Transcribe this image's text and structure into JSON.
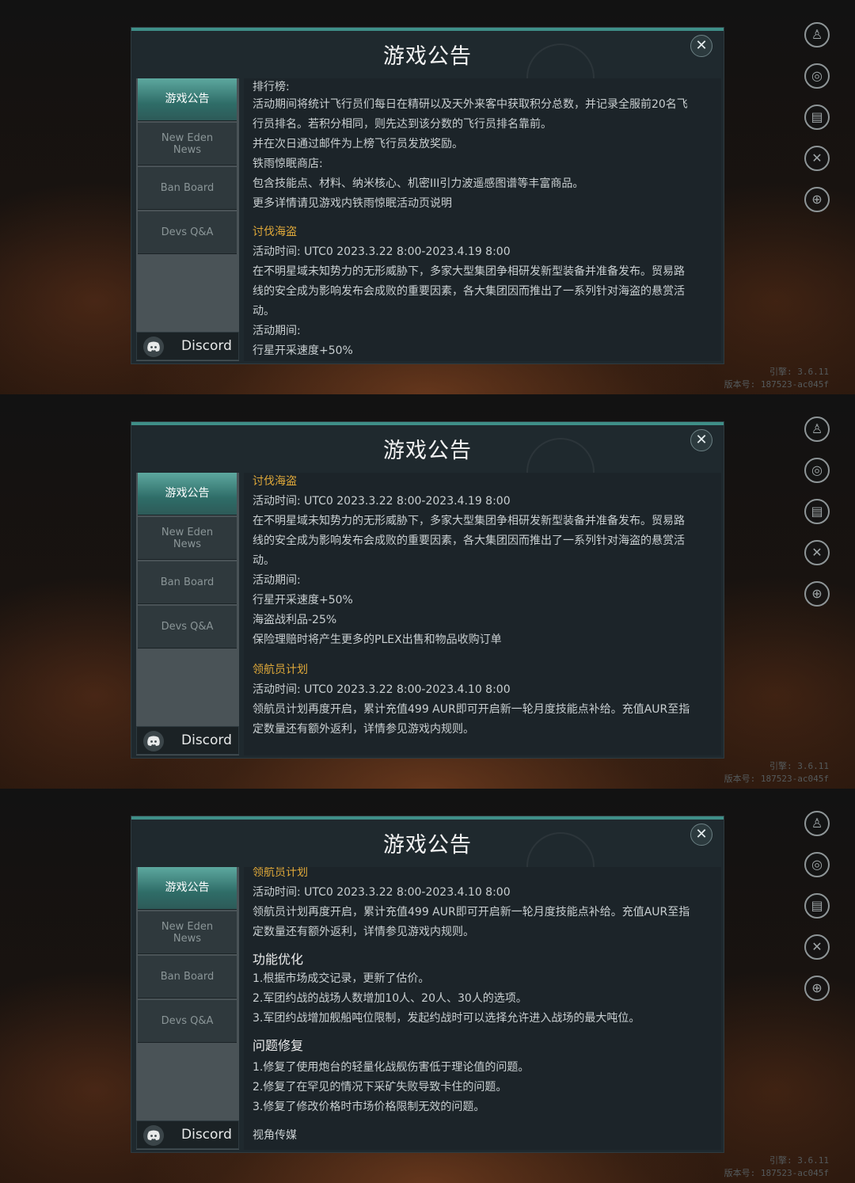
{
  "dialog_title": "游戏公告",
  "close_symbol": "✕",
  "tabs": [
    "游戏公告",
    "New Eden\nNews",
    "Ban Board",
    "Devs Q&A"
  ],
  "discord_label": "Discord",
  "version_engine": "引擎: 3.6.11",
  "version_build": "版本号: 187523-ac045f",
  "rail_icons": [
    "profile-icon",
    "signal-icon",
    "notes-icon",
    "tools-icon",
    "globe-icon"
  ],
  "frames": [
    {
      "lines": [
        {
          "text": "排行榜:",
          "style": "normal"
        },
        {
          "text": "活动期间将统计飞行员们每日在精研以及天外来客中获取积分总数，并记录全服前20名飞",
          "style": "normal"
        },
        {
          "text": "行员排名。若积分相同，则先达到该分数的飞行员排名靠前。",
          "style": "normal"
        },
        {
          "text": "并在次日通过邮件为上榜飞行员发放奖励。",
          "style": "normal"
        },
        {
          "text": "铁雨惊眠商店:",
          "style": "normal"
        },
        {
          "text": "包含技能点、材料、纳米核心、机密III引力波遥感图谱等丰富商品。",
          "style": "normal"
        },
        {
          "text": "更多详情请见游戏内铁雨惊眠活动页说明",
          "style": "normal"
        },
        {
          "text": "讨伐海盗",
          "style": "hl"
        },
        {
          "text": "活动时间: UTC0 2023.3.22 8:00-2023.4.19 8:00",
          "style": "normal"
        },
        {
          "text": "在不明星域未知势力的无形威胁下，多家大型集团争相研发新型装备并准备发布。贸易路",
          "style": "normal"
        },
        {
          "text": "线的安全成为影响发布会成败的重要因素，各大集团因而推出了一系列针对海盗的悬赏活",
          "style": "normal"
        },
        {
          "text": "动。",
          "style": "normal"
        },
        {
          "text": "活动期间:",
          "style": "normal"
        },
        {
          "text": "行星开采速度+50%",
          "style": "normal"
        }
      ]
    },
    {
      "lines": [
        {
          "text": "讨伐海盗",
          "style": "hl"
        },
        {
          "text": "活动时间: UTC0 2023.3.22 8:00-2023.4.19 8:00",
          "style": "normal"
        },
        {
          "text": "在不明星域未知势力的无形威胁下，多家大型集团争相研发新型装备并准备发布。贸易路",
          "style": "normal"
        },
        {
          "text": "线的安全成为影响发布会成败的重要因素，各大集团因而推出了一系列针对海盗的悬赏活",
          "style": "normal"
        },
        {
          "text": "动。",
          "style": "normal"
        },
        {
          "text": "活动期间:",
          "style": "normal"
        },
        {
          "text": "行星开采速度+50%",
          "style": "normal"
        },
        {
          "text": "海盗战利品-25%",
          "style": "normal"
        },
        {
          "text": "保险理赔时将产生更多的PLEX出售和物品收购订单",
          "style": "normal"
        },
        {
          "text": "领航员计划",
          "style": "hl"
        },
        {
          "text": "活动时间: UTC0 2023.3.22 8:00-2023.4.10 8:00",
          "style": "normal"
        },
        {
          "text": "领航员计划再度开启，累计充值499 AUR即可开启新一轮月度技能点补给。充值AUR至指",
          "style": "normal"
        },
        {
          "text": "定数量还有额外返利，详情参见游戏内规则。",
          "style": "normal"
        }
      ]
    },
    {
      "lines": [
        {
          "text": "领航员计划",
          "style": "hl"
        },
        {
          "text": "活动时间: UTC0 2023.3.22 8:00-2023.4.10 8:00",
          "style": "normal"
        },
        {
          "text": "领航员计划再度开启，累计充值499 AUR即可开启新一轮月度技能点补给。充值AUR至指",
          "style": "normal"
        },
        {
          "text": "定数量还有额外返利，详情参见游戏内规则。",
          "style": "normal"
        },
        {
          "text": "功能优化",
          "style": "section"
        },
        {
          "text": "1.根据市场成交记录，更新了估价。",
          "style": "normal"
        },
        {
          "text": "2.军团约战的战场人数增加10人、20人、30人的选项。",
          "style": "normal"
        },
        {
          "text": "3.军团约战增加舰船吨位限制，发起约战时可以选择允许进入战场的最大吨位。",
          "style": "normal"
        },
        {
          "text": "问题修复",
          "style": "section"
        },
        {
          "text": "1.修复了使用炮台的轻量化战舰伤害低于理论值的问题。",
          "style": "normal"
        },
        {
          "text": "2.修复了在罕见的情况下采矿失败导致卡住的问题。",
          "style": "normal"
        },
        {
          "text": "3.修复了修改价格时市场价格限制无效的问题。",
          "style": "normal"
        },
        {
          "text": "视角传媒",
          "style": "normal"
        }
      ]
    }
  ]
}
